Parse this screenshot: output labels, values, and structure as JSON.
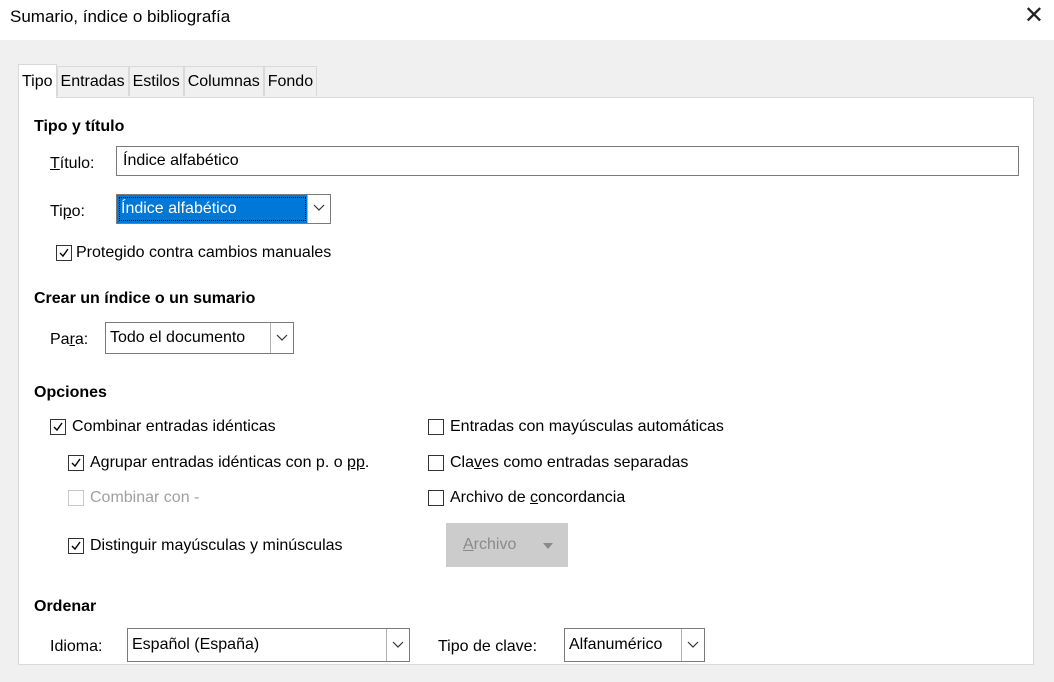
{
  "window": {
    "title": "Sumario, índice o bibliografía",
    "close_glyph": "✕"
  },
  "tabs": [
    {
      "label": "Tipo",
      "active": true
    },
    {
      "label": "Entradas",
      "active": false
    },
    {
      "label": "Estilos",
      "active": false
    },
    {
      "label": "Columnas",
      "active": false
    },
    {
      "label": "Fondo",
      "active": false
    }
  ],
  "type_title": {
    "heading": "Tipo y título",
    "title_label_ul": "T",
    "title_label_rest": "ítulo:",
    "title_value": "Índice alfabético",
    "type_label_a": "Ti",
    "type_label_ul": "p",
    "type_label_b": "o:",
    "type_value": "Índice alfabético",
    "protected_a": "Prote",
    "protected_ul": "g",
    "protected_b": "ido contra cambios manuales",
    "protected_checked": true
  },
  "create": {
    "heading": "Crear un índice o un sumario",
    "for_label_a": "Pa",
    "for_label_ul": "r",
    "for_label_b": "a:",
    "for_value": "Todo el documento"
  },
  "options": {
    "heading": "Opciones",
    "combine_identical": "Combinar entradas idénticas",
    "group_identical_a": "Agrupar entradas idénticas con p. o ",
    "group_identical_ul": "pp",
    "group_identical_b": ".",
    "combine_with": "Combinar con -",
    "case_sensitive": "Distinguir mayúsculas y minúsculas",
    "auto_caps": "Entradas con mayúsculas automáticas",
    "keys_separate_a": "Cla",
    "keys_separate_ul": "v",
    "keys_separate_b": "es como entradas separadas",
    "concordance_a": "Archivo de ",
    "concordance_ul": "c",
    "concordance_b": "oncordancia",
    "file_button_ul": "A",
    "file_button_b": "rchivo"
  },
  "sort": {
    "heading": "Ordenar",
    "language_label": "Idioma:",
    "language_value": "Español (España)",
    "key_type_label": "Tipo de clave:",
    "key_type_value": "Alfanumérico"
  },
  "colors": {
    "accent": "#0078d7",
    "dialog_bg": "#f0f0f0",
    "disabled_button": "#cccccc"
  },
  "icons": [
    "close-icon",
    "chevron-down-icon",
    "checkmark-icon"
  ]
}
